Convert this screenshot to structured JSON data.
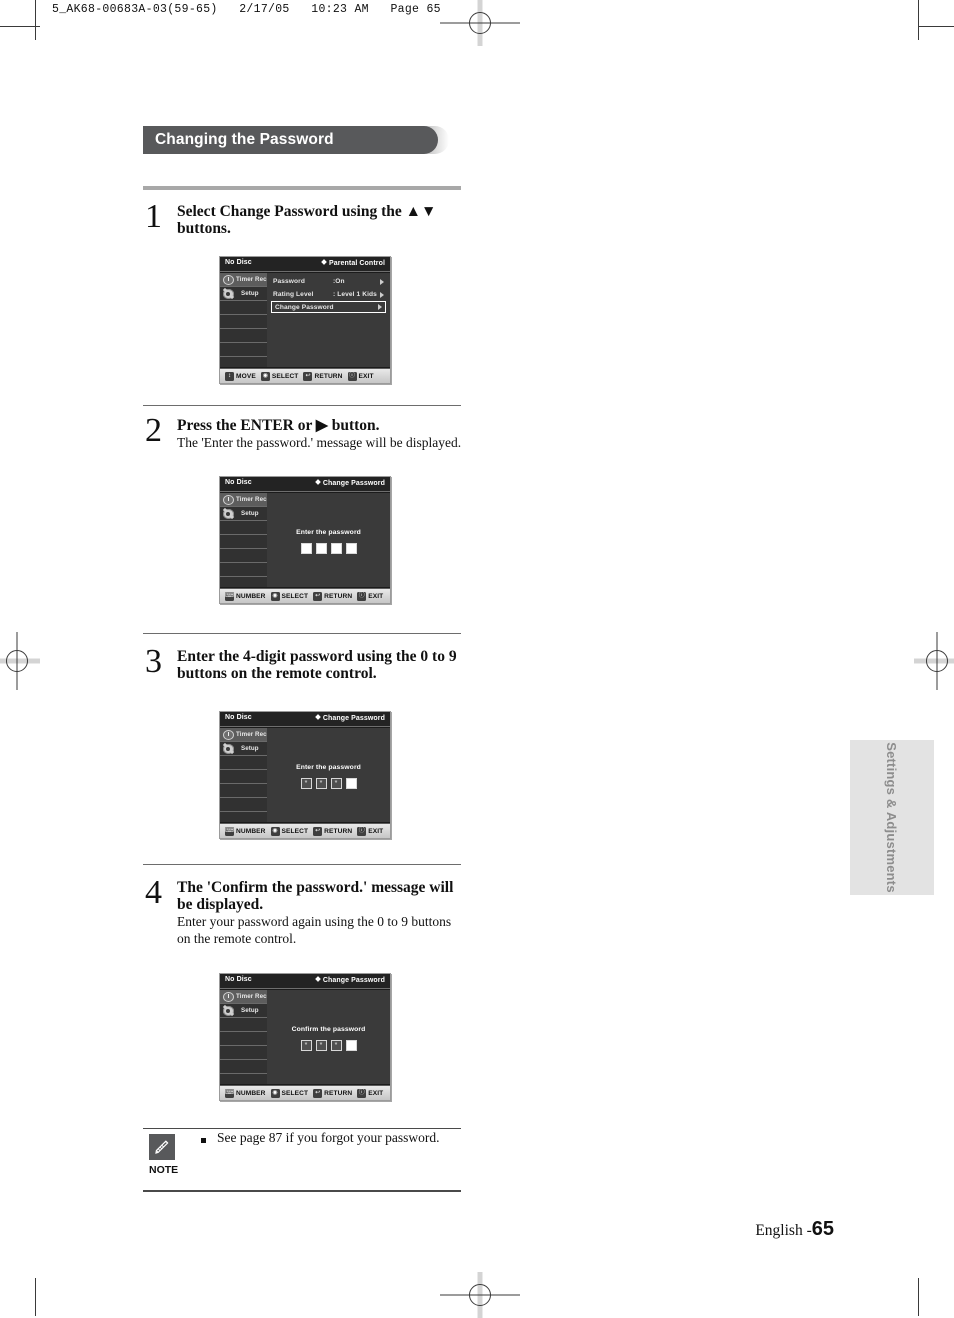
{
  "print_slug": "5_AK68-00683A-03(59-65)   2/17/05   10:23 AM   Page 65",
  "section": {
    "title": "Changing the Password"
  },
  "steps": [
    {
      "number": "1",
      "title": "Select Change Password using the ▲▼ buttons.",
      "sub": ""
    },
    {
      "number": "2",
      "title": "Press the ENTER or ▶ button.",
      "sub": "The 'Enter the password.' message will be displayed."
    },
    {
      "number": "3",
      "title": "Enter the 4-digit password using the 0 to 9 buttons on the remote control.",
      "sub": ""
    },
    {
      "number": "4",
      "title": "The 'Confirm the password.' message will be displayed.",
      "sub": "Enter your password again using the 0 to 9 buttons on the remote control."
    }
  ],
  "osd": {
    "disc_status": "No Disc",
    "sidebar": {
      "timer_rec": "Timer Rec.",
      "setup": "Setup"
    },
    "screen1": {
      "breadcrumb": "Parental Control",
      "rows": [
        {
          "name": "Password",
          "value": ":On",
          "selected": false
        },
        {
          "name": "Rating Level",
          "value": ": Level 1 Kids",
          "selected": false
        },
        {
          "name": "Change Password",
          "value": "",
          "selected": true
        }
      ],
      "buttons": [
        {
          "key": "↕",
          "label": "MOVE"
        },
        {
          "key": "◉",
          "label": "SELECT"
        },
        {
          "key": "↩",
          "label": "RETURN"
        },
        {
          "key": "ⓘ",
          "label": "EXIT"
        }
      ]
    },
    "screen2": {
      "breadcrumb": "Change Password",
      "message": "Enter the password",
      "boxes": [
        "",
        "",
        "",
        ""
      ],
      "buttons": [
        {
          "key": "⌨",
          "label": "NUMBER"
        },
        {
          "key": "◉",
          "label": "SELECT"
        },
        {
          "key": "↩",
          "label": "RETURN"
        },
        {
          "key": "ⓘ",
          "label": "EXIT"
        }
      ]
    },
    "screen3": {
      "breadcrumb": "Change Password",
      "message": "Enter the password",
      "boxes": [
        "*",
        "*",
        "*",
        ""
      ],
      "buttons": [
        {
          "key": "⌨",
          "label": "NUMBER"
        },
        {
          "key": "◉",
          "label": "SELECT"
        },
        {
          "key": "↩",
          "label": "RETURN"
        },
        {
          "key": "ⓘ",
          "label": "EXIT"
        }
      ]
    },
    "screen4": {
      "breadcrumb": "Change Password",
      "message": "Confirm the password",
      "boxes": [
        "*",
        "*",
        "*",
        ""
      ],
      "buttons": [
        {
          "key": "⌨",
          "label": "NUMBER"
        },
        {
          "key": "◉",
          "label": "SELECT"
        },
        {
          "key": "↩",
          "label": "RETURN"
        },
        {
          "key": "ⓘ",
          "label": "EXIT"
        }
      ]
    }
  },
  "note": {
    "label": "NOTE",
    "text": "See page 87 if you forgot your password."
  },
  "side_tab": {
    "label": "Settings & Adjustments"
  },
  "footer": {
    "language": "English -",
    "page": "65"
  },
  "colors": {
    "banner": "#58595b",
    "rule": "#a8a8a8",
    "side_tab_bg": "#e3e3e3",
    "osd_bg": "#1b1b1b",
    "osd_panel": "#3a3a3a"
  }
}
